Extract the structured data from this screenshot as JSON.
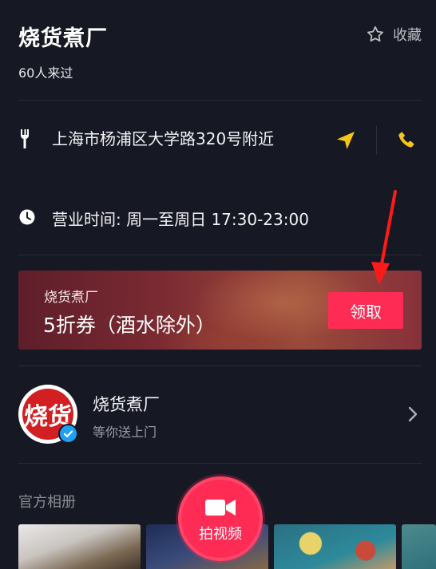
{
  "shop": {
    "title": "烧货煮厂",
    "visitors": "60人来过",
    "favorite_label": "收藏"
  },
  "info": {
    "address": "上海市杨浦区大学路320号附近",
    "hours": "营业时间: 周一至周日 17:30-23:00"
  },
  "coupon": {
    "shop_name": "烧货煮厂",
    "title": "5折券（酒水除外）",
    "claim_label": "领取"
  },
  "merchant": {
    "name": "烧货煮厂",
    "subtitle": "等你送上门",
    "logo_text": "烧货"
  },
  "album": {
    "label": "官方相册"
  },
  "shoot": {
    "label": "拍视频"
  },
  "colors": {
    "accent": "#fe2c55",
    "icon_yellow": "#f5c518",
    "annotation_red": "#ff1a1a",
    "background": "#161823"
  }
}
